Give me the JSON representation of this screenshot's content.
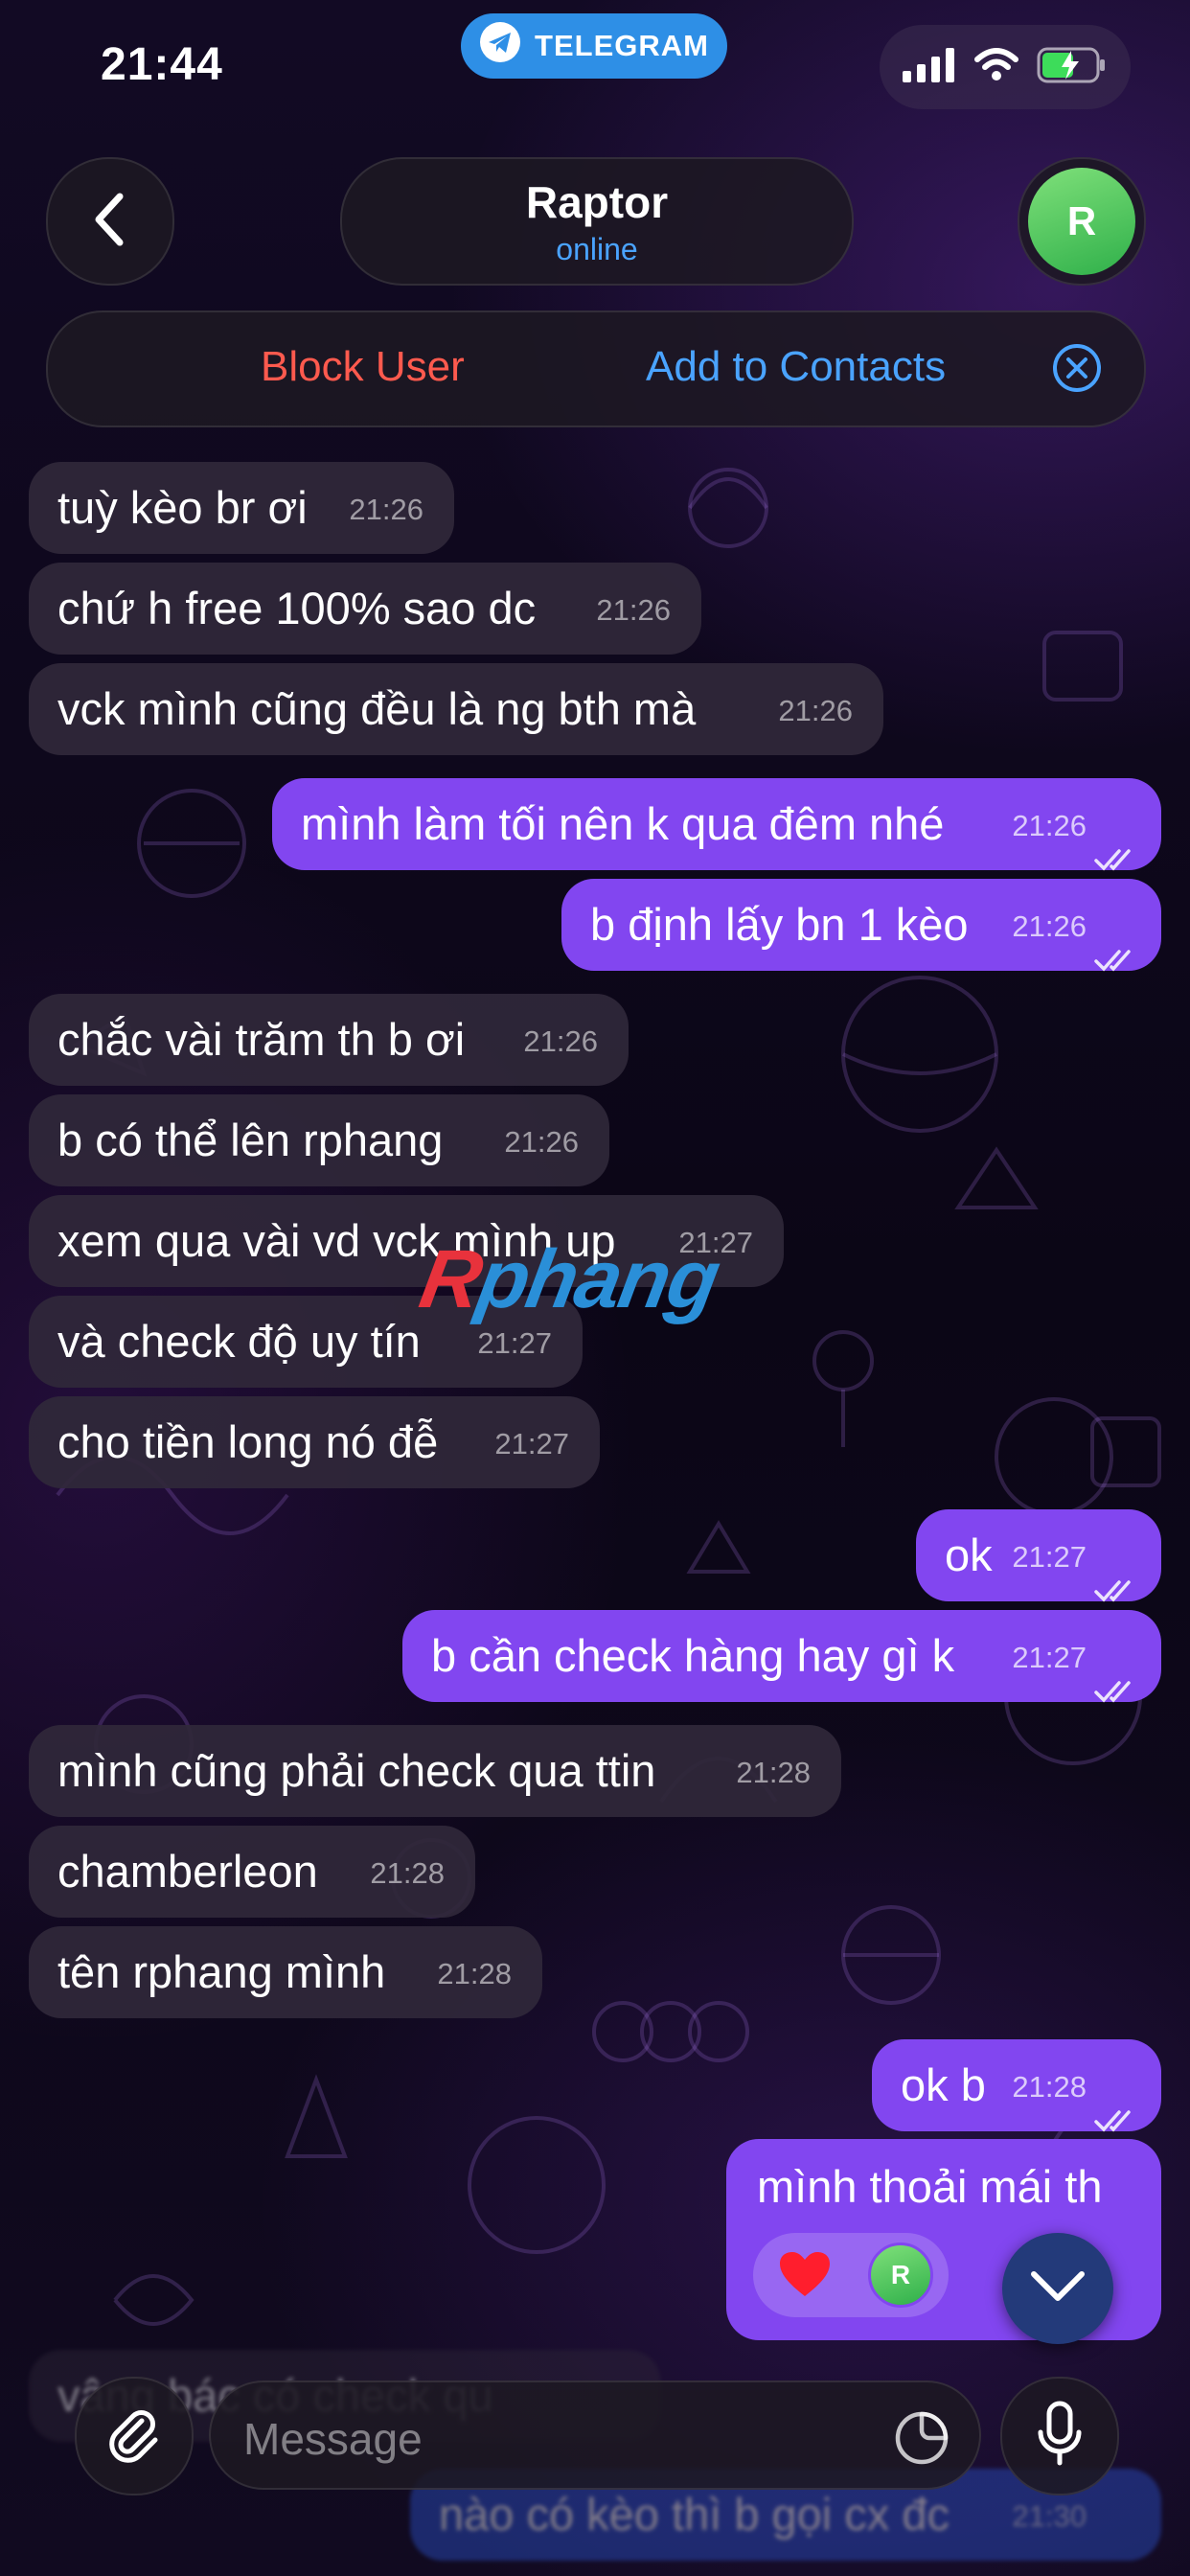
{
  "status_bar": {
    "time": "21:44",
    "return_app": "TELEGRAM",
    "icons": [
      "signal-icon",
      "wifi-icon",
      "battery-charging-icon"
    ]
  },
  "header": {
    "back_icon": "chevron-left-icon",
    "name": "Raptor",
    "status": "online",
    "avatar_letter": "R"
  },
  "action_bar": {
    "block_label": "Block User",
    "add_label": "Add to Contacts",
    "dismiss_icon": "close-circle-icon"
  },
  "messages": [
    {
      "dir": "in",
      "text": "tuỳ kèo br ơi",
      "time": "21:26"
    },
    {
      "dir": "in",
      "text": "chứ h free 100% sao dc",
      "time": "21:26"
    },
    {
      "dir": "in",
      "text": "vck mình cũng đều là ng bth mà",
      "time": "21:26"
    },
    {
      "dir": "out",
      "text": "mình làm tối nên k qua đêm nhé",
      "time": "21:26"
    },
    {
      "dir": "out",
      "text": "b định lấy bn 1 kèo",
      "time": "21:26"
    },
    {
      "dir": "in",
      "text": "chắc vài trăm th b ơi",
      "time": "21:26"
    },
    {
      "dir": "in",
      "text": "b có thể lên rphang",
      "time": "21:26"
    },
    {
      "dir": "in",
      "text": "xem qua vài vd vck mình up",
      "time": "21:27"
    },
    {
      "dir": "in",
      "text": "và check độ uy tín",
      "time": "21:27"
    },
    {
      "dir": "in",
      "text": "cho tiền long nó đễ",
      "time": "21:27"
    },
    {
      "dir": "out",
      "text": "ok",
      "time": "21:27"
    },
    {
      "dir": "out",
      "text": "b cần check hàng hay gì k",
      "time": "21:27"
    },
    {
      "dir": "in",
      "text": "mình cũng phải check qua ttin",
      "time": "21:28"
    },
    {
      "dir": "in",
      "text": "chamberleon",
      "time": "21:28"
    },
    {
      "dir": "in",
      "text": "tên rphang mình",
      "time": "21:28"
    },
    {
      "dir": "out",
      "text": "ok b",
      "time": "21:28"
    }
  ],
  "last_outgoing": {
    "text": "mình thoải mái th",
    "reaction_emoji": "heart-icon",
    "reaction_avatar_letter": "R"
  },
  "faded_messages": [
    {
      "text": "vâng bác có check qu",
      "time": ""
    },
    {
      "text": "nào có kèo thì b gọi cx đc",
      "time": "21:30"
    }
  ],
  "watermark": {
    "first": "R",
    "rest": "phang"
  },
  "input": {
    "placeholder": "Message",
    "attach_icon": "paperclip-icon",
    "sticker_icon": "sticker-icon",
    "mic_icon": "microphone-icon",
    "scroll_icon": "chevron-down-icon"
  },
  "colors": {
    "outgoing_bubble": "#8246f0",
    "incoming_bubble": "#30283a",
    "link_blue": "#4aa3ff",
    "danger_red": "#ff5a4e",
    "telegram_pill": "#2e8fe6"
  }
}
